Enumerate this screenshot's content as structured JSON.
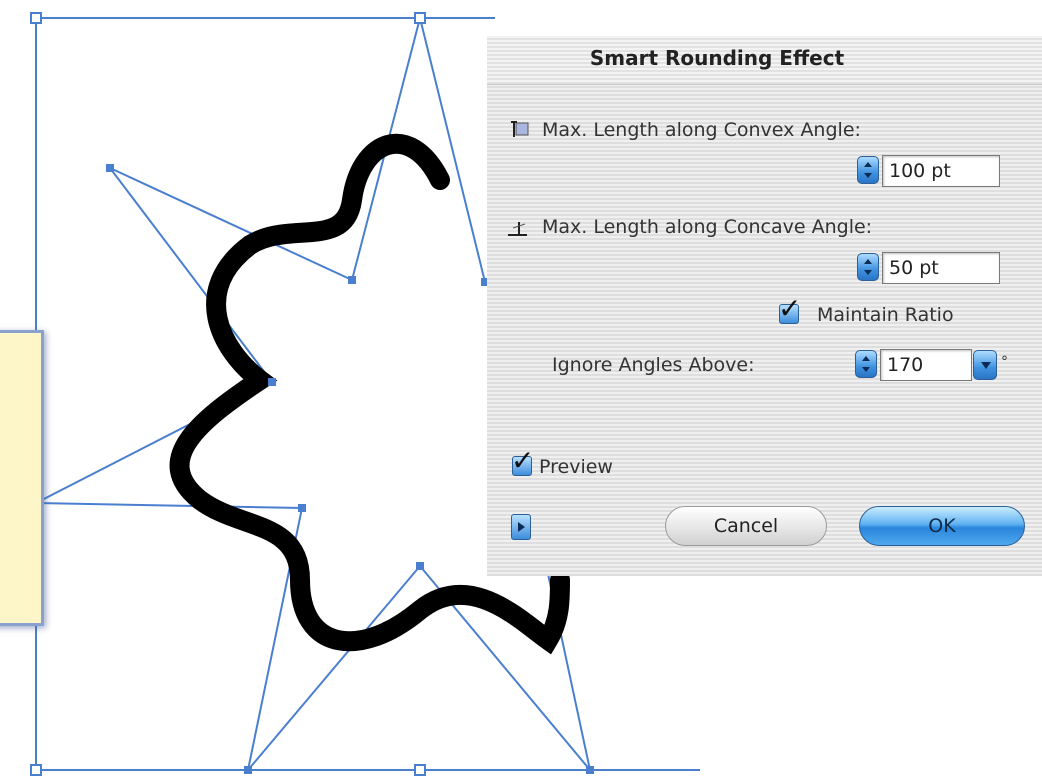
{
  "dialog": {
    "title": "Smart Rounding Effect",
    "convex_label": "Max. Length along Convex Angle:",
    "convex_value": "100 pt",
    "concave_label": "Max. Length along Concave Angle:",
    "concave_value": "50 pt",
    "maintain_ratio_label": "Maintain Ratio",
    "maintain_ratio_checked": true,
    "ignore_angles_label": "Ignore Angles Above:",
    "ignore_angles_value": "170",
    "degree_symbol": "°",
    "preview_label": "Preview",
    "preview_checked": true,
    "cancel_label": "Cancel",
    "ok_label": "OK"
  },
  "colors": {
    "path_stroke": "#000000",
    "guide_lines": "#4a7fd0",
    "accent_button": "#3f92e0"
  },
  "icons": [
    "convex-angle-icon",
    "concave-angle-icon",
    "checkmark-icon",
    "disclosure-triangle-icon",
    "stepper-arrows-icon",
    "dropdown-arrow-icon"
  ]
}
